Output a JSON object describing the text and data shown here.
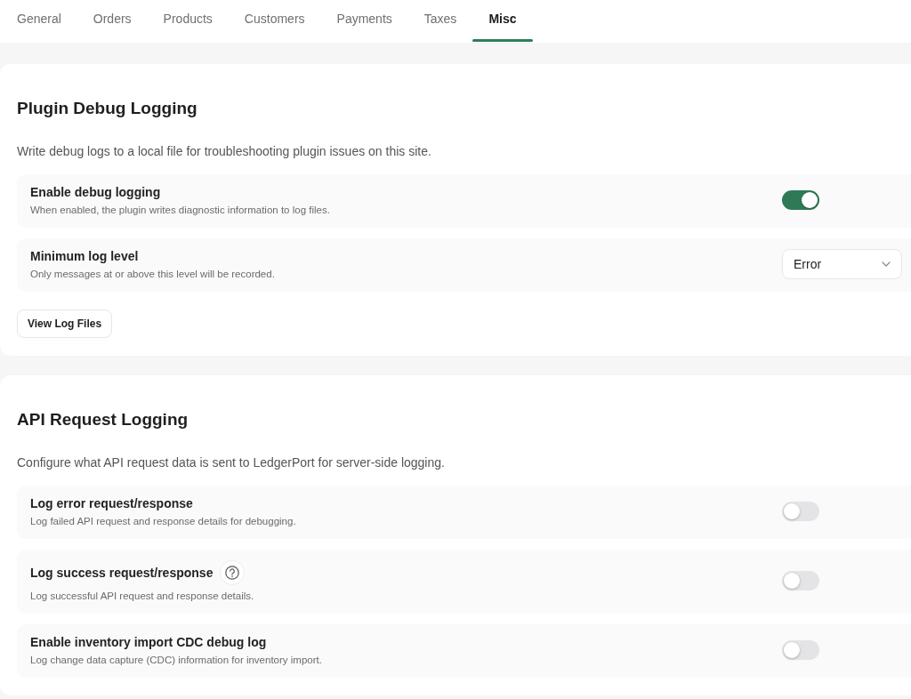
{
  "tabs": [
    {
      "label": "General",
      "selected": false
    },
    {
      "label": "Orders",
      "selected": false
    },
    {
      "label": "Products",
      "selected": false
    },
    {
      "label": "Customers",
      "selected": false
    },
    {
      "label": "Payments",
      "selected": false
    },
    {
      "label": "Taxes",
      "selected": false
    },
    {
      "label": "Misc",
      "selected": true
    }
  ],
  "sections": [
    {
      "title": "Plugin Debug Logging",
      "description": "Write debug logs to a local file for troubleshooting plugin issues on this site.",
      "settings": [
        {
          "kind": "toggle",
          "label": "Enable debug logging",
          "help": false,
          "description": "When enabled, the plugin writes diagnostic information to log files.",
          "on": true
        },
        {
          "kind": "select",
          "label": "Minimum log level",
          "help": false,
          "description": "Only messages at or above this level will be recorded.",
          "value": "Error"
        }
      ],
      "buttons": [
        "View Log Files"
      ]
    },
    {
      "title": "API Request Logging",
      "description": "Configure what API request data is sent to LedgerPort for server-side logging.",
      "settings": [
        {
          "kind": "toggle",
          "label": "Log error request/response",
          "help": false,
          "description": "Log failed API request and response details for debugging.",
          "on": false
        },
        {
          "kind": "toggle",
          "label": "Log success request/response",
          "help": true,
          "description": "Log successful API request and response details.",
          "on": false
        },
        {
          "kind": "toggle",
          "label": "Enable inventory import CDC debug log",
          "help": false,
          "description": "Log change data capture (CDC) information for inventory import.",
          "on": false
        }
      ]
    }
  ]
}
